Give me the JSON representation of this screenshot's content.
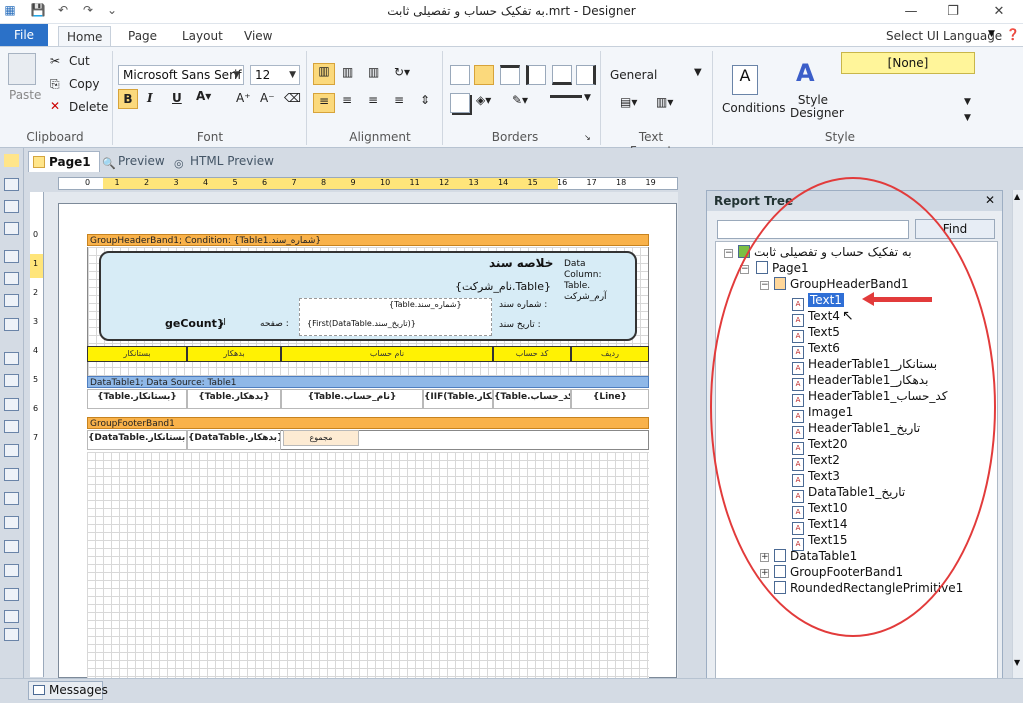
{
  "app": {
    "title": "به تفکیک حساب و تفصیلی ثابت.mrt - Designer"
  },
  "ribbon_tabs": [
    "File",
    "Home",
    "Page",
    "Layout",
    "View"
  ],
  "select_language": "Select UI Language",
  "clipboard": {
    "paste": "Paste",
    "cut": "Cut",
    "copy": "Copy",
    "delete": "Delete",
    "label": "Clipboard"
  },
  "font": {
    "name": "Microsoft Sans Serif",
    "size": "12",
    "label": "Font"
  },
  "alignment": {
    "label": "Alignment"
  },
  "borders": {
    "label": "Borders"
  },
  "text_format": {
    "value": "General",
    "label": "Text Format"
  },
  "style": {
    "conditions": "Conditions",
    "designer": "Style Designer",
    "current": "[None]",
    "label": "Style"
  },
  "doc_tabs": {
    "page1": "Page1",
    "preview": "Preview",
    "html_preview": "HTML Preview"
  },
  "ruler_ticks": [
    "0",
    "1",
    "2",
    "3",
    "4",
    "5",
    "6",
    "7",
    "8",
    "9",
    "10",
    "11",
    "12",
    "13",
    "14",
    "15",
    "16",
    "17",
    "18",
    "19"
  ],
  "vruler_ticks": [
    "0",
    "1",
    "2",
    "3",
    "4",
    "5",
    "6",
    "7"
  ],
  "report": {
    "group_header": "GroupHeaderBand1; Condition: {Table1.شماره_سند}",
    "summary_title": "خلاصه سند",
    "company": "{Table.نام_شرکت}",
    "data_column": "Data Column: Table. آرم_شرکت",
    "doc_number_label": "شماره سند :",
    "doc_number_value": "{Table.شماره_سند}",
    "doc_date_label": "تاریخ سند :",
    "doc_date_value": "{First(DataTable.تاریخ_سند)}",
    "page_label": "صفحه :",
    "page_count": "geCount}",
    "of_label": "از",
    "headers": [
      "ردیف",
      "کد حساب",
      "نام حساب",
      "بدهکار",
      "بستانکار"
    ],
    "data_band": "DataTable1; Data Source: Table1",
    "data_cells": [
      "{Line}",
      "{Table.کد_حساب}",
      "{IIF(Table.بدهکار>...",
      "{Table.نام_حساب}",
      "{Table.بدهکار}",
      "{Table.بستانکار}"
    ],
    "footer_band": "GroupFooterBand1",
    "footer_total": "مجموع",
    "footer_cells": [
      "{DataTable.بدهکار}",
      "{DataTable.بستانکار}"
    ]
  },
  "report_tree": {
    "title": "Report Tree",
    "find": "Find",
    "search_value": "",
    "root": "به تفکیک حساب و تفصیلی ثابت",
    "page": "Page1",
    "group_header": "GroupHeaderBand1",
    "children": [
      "Text1",
      "Text4",
      "Text5",
      "Text6",
      "HeaderTable1_بستانکار",
      "HeaderTable1_بدهکار",
      "HeaderTable1_کد_حساب",
      "Image1",
      "HeaderTable1_تاریخ",
      "Text20",
      "Text2",
      "Text3",
      "DataTable1_تاریخ",
      "Text10",
      "Text14",
      "Text15"
    ],
    "siblings": [
      "DataTable1",
      "GroupFooterBand1",
      "RoundedRectanglePrimitive1"
    ],
    "selected": "Text1"
  },
  "status": {
    "messages": "Messages"
  }
}
